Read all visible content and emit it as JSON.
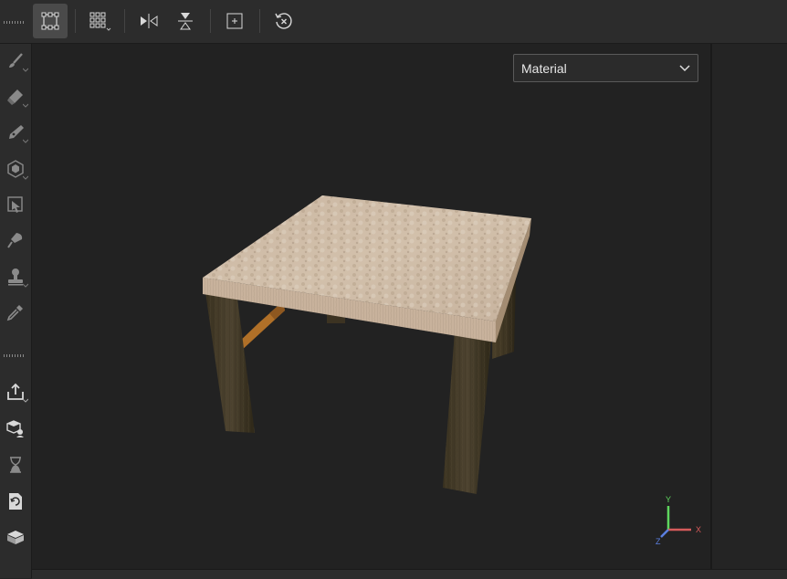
{
  "toolbar": {
    "tools": [
      {
        "name": "selection-frame-icon",
        "active": true
      },
      {
        "name": "grid-options-icon"
      },
      {
        "name": "mirror-horizontal-icon"
      },
      {
        "name": "mirror-vertical-icon"
      },
      {
        "name": "frame-center-icon"
      },
      {
        "name": "reset-camera-icon"
      }
    ]
  },
  "left_tools": [
    "brush-icon",
    "eraser-icon",
    "pen-icon",
    "polygon-fill-icon",
    "projection-icon",
    "smudge-icon",
    "clone-stamp-icon",
    "color-picker-icon",
    "export-icon",
    "bake-icon",
    "timer-icon",
    "refresh-file-icon",
    "mesh-icon"
  ],
  "viewport": {
    "channel_dropdown": {
      "selected": "Material"
    },
    "axes": {
      "x": "X",
      "y": "Y",
      "z": "Z"
    },
    "colors": {
      "x_axis": "#d65b5b",
      "y_axis": "#5ed65e",
      "z_axis": "#5b7fe0"
    }
  }
}
